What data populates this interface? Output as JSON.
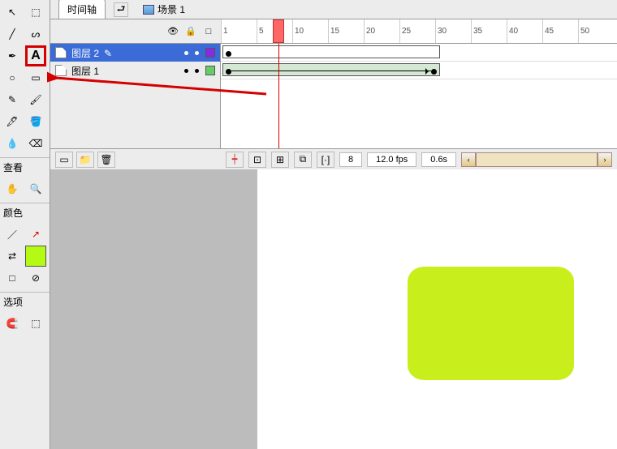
{
  "tabs": {
    "timeline": "时间轴",
    "scene": "场景 1"
  },
  "ruler_ticks": [
    "1",
    "5",
    "10",
    "15",
    "20",
    "25",
    "30",
    "35",
    "40",
    "45",
    "50"
  ],
  "layers": [
    {
      "name": "图层 2",
      "active": true,
      "color": "#8a2be2"
    },
    {
      "name": "图层 1",
      "active": false,
      "color": "#66cc66"
    }
  ],
  "footer": {
    "frame": "8",
    "fps": "12.0 fps",
    "time": "0.6s"
  },
  "sections": {
    "view": "查看",
    "color": "颜色",
    "options": "选项"
  },
  "playhead_frame": 8,
  "colors": {
    "accent_fill": "#b4fa14",
    "shape": "#c8ef1c"
  },
  "icons": {
    "arrow": "↖",
    "subselect": "⬚",
    "line": "╱",
    "lasso": "ᔕ",
    "pen": "✒",
    "text": "A",
    "oval": "○",
    "rect": "▭",
    "pencil": "✎",
    "brush": "🖌",
    "ink": "🖋",
    "paint": "🪣",
    "dropper": "💧",
    "eraser": "⌫",
    "hand": "✋",
    "zoom": "🔍",
    "stroke": "／",
    "fill": "↗",
    "swap": "⇄",
    "none": "⊘",
    "magnet": "🧲",
    "eye": "👁",
    "lock": "🔒",
    "square": "□",
    "folder": "📁",
    "trash": "🗑",
    "back": "⮐",
    "left": "‹",
    "right": "›",
    "onion1": "⊡",
    "onion2": "⊞",
    "onion3": "⧉",
    "bracket": "[·]"
  }
}
